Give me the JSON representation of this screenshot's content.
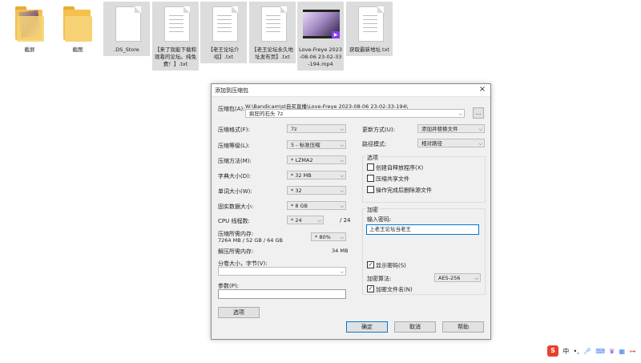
{
  "desktop": {
    "items": [
      {
        "label": "截屏",
        "kind": "folder-photo"
      },
      {
        "label": "截图",
        "kind": "folder"
      },
      {
        "label": ".DS_Store",
        "kind": "doc"
      },
      {
        "label": "【来了就能下载和观看的论坛。纯免费！】.txt",
        "kind": "doc"
      },
      {
        "label": "【老王论坛介绍】.txt",
        "kind": "doc"
      },
      {
        "label": "【老王论坛永久地址发布页】.txt",
        "kind": "doc"
      },
      {
        "label": "Love-Freye 2023-08-06 23-02-33-194.mp4",
        "kind": "video"
      },
      {
        "label": "获取最新地址.txt",
        "kind": "doc"
      }
    ]
  },
  "dialog": {
    "title": "添加到压缩包",
    "close_glyph": "×",
    "archive_label": "压缩包(A):",
    "archive_path": "W:\\Bandicam\\st自买直播\\Love-Freye 2023-08-06 23-02-33-194\\",
    "archive_name": "疯狂的石头 7z",
    "browse_label": "...",
    "left": {
      "format_label": "压缩格式(F):",
      "format_value": "7z",
      "level_label": "压缩等级(L):",
      "level_value": "5 - 标准压缩",
      "method_label": "压缩方法(M):",
      "method_value": "* LZMA2",
      "dict_label": "字典大小(D):",
      "dict_value": "* 32 MB",
      "word_label": "单词大小(W):",
      "word_value": "* 32",
      "solid_label": "固实数据大小:",
      "solid_value": "* 8 GB",
      "cpu_label": "CPU 线程数:",
      "cpu_value": "* 24",
      "cpu_total": "/ 24",
      "mem_label": "压缩所需内存:",
      "mem_detail": "7264 MB / 52 GB / 64 GB",
      "mem_percent": "* 80%",
      "decomp_label": "解压所需内存:",
      "decomp_value": "34 MB",
      "split_label": "分卷大小，字节(V):",
      "split_value": "",
      "params_label": "参数(P):",
      "params_value": "",
      "options_button": "选项"
    },
    "right": {
      "update_label": "更新方式(U):",
      "update_value": "添加并替换文件",
      "path_label": "路径模式:",
      "path_value": "相对路径",
      "options_title": "选项",
      "opt_sfx": "创建自释放程序(X)",
      "opt_shared": "压缩共享文件",
      "opt_delete": "操作完成后删除源文件",
      "enc_title": "加密",
      "pwd_label": "输入密码:",
      "pwd_value": "上老王论坛当老王",
      "show_pwd": "显示密码(S)",
      "enc_method_label": "加密算法:",
      "enc_method_value": "AES-256",
      "enc_names": "加密文件名(N)"
    },
    "buttons": {
      "ok": "确定",
      "cancel": "取消",
      "help": "帮助"
    }
  },
  "tray": {
    "ime_logo": "S",
    "ime_mode": "中",
    "punct": "•,"
  }
}
